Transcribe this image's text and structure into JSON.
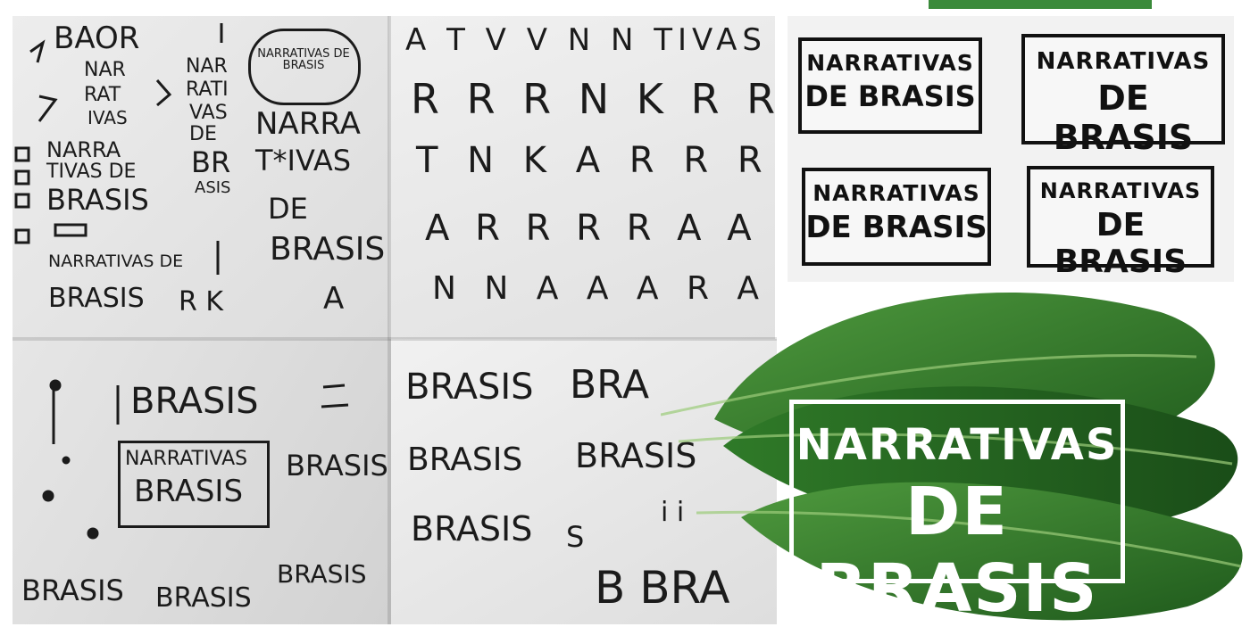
{
  "sheet1": {
    "t1": "BAOR",
    "t2": "NAR",
    "t3": "RAT",
    "t4": "IVAS",
    "t5": "NAR",
    "t6": "RATI",
    "t7": "VAS",
    "t8": "DE",
    "t9": "BR",
    "t10": "ASIS",
    "bubble": "NARRATIVAS DE BRASIS",
    "t11": "NARRA",
    "t12": "TIVAS DE",
    "t13": "BRASIS",
    "t14": "NARRA",
    "t15": "T*IVAS",
    "t16": "DE",
    "t17": "BRASIS",
    "t18": "NARRATIVAS DE",
    "t19": "BRASIS",
    "t20": "R K",
    "t21": "A"
  },
  "sheet2": {
    "r1": "A T V V N N TIVAS",
    "r2": "R R R N K R R A",
    "r3": "T N K A R R R R",
    "r4": "A R R R R A A R TIV",
    "r5": "N N A A A R A A"
  },
  "sheet3": {
    "t1": "BRASIS",
    "box1": "NARRATIVAS",
    "box2": "BRASIS",
    "t2": "BRASIS",
    "t3": "BRASIS",
    "t4": "BRASIS",
    "t5": "BRASIS"
  },
  "sheet4": {
    "t1": "BRASIS",
    "t2": "BRA",
    "t3": "BRASIS",
    "t4": "BRASIS",
    "t5": "BRASIS",
    "t6": "S",
    "t7": "i i",
    "t8": "B BRA"
  },
  "studies": [
    {
      "line1": "NARRATIVAS",
      "line2": "DE BRASIS"
    },
    {
      "line1": "NARRATIVAS",
      "line2": "DE BRASIS"
    },
    {
      "line1": "NARRATIVAS",
      "line2": "DE BRASIS"
    },
    {
      "line1": "NARRATIVAS",
      "line2": "DE BRASIS"
    }
  ],
  "final_logo": {
    "line1": "NARRATIVAS",
    "line2": "DE BRASIS"
  },
  "colors": {
    "leaf_dark": "#1f5a1c",
    "leaf_mid": "#2f7a28",
    "leaf_light": "#4f9a3e",
    "accent_green": "#3a8a3a"
  }
}
